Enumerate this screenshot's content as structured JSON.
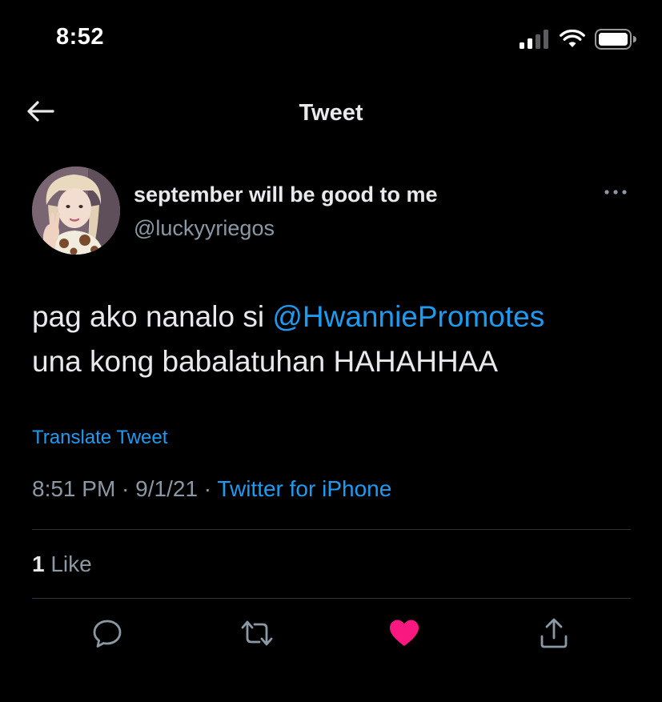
{
  "status_bar": {
    "time": "8:52",
    "icons": [
      "cellular-signal-icon",
      "wifi-icon",
      "battery-icon"
    ]
  },
  "nav": {
    "back_icon": "arrow-left-icon",
    "title": "Tweet"
  },
  "tweet": {
    "author": {
      "display_name": "september will be good to me",
      "handle": "@luckyyriegos"
    },
    "text_line1_prefix": "pag ako nanalo si ",
    "mention": "@HwanniePromotes",
    "text_line2": "una kong babalatuhan HAHAHHAA",
    "translate_label": "Translate Tweet",
    "time": "8:51 PM",
    "separator1": " · ",
    "date": "9/1/21",
    "separator2": " · ",
    "source": "Twitter for iPhone",
    "likes_count": "1",
    "likes_label": " Like",
    "liked": true
  },
  "actions": [
    "reply-icon",
    "retweet-icon",
    "like-icon",
    "share-icon"
  ],
  "colors": {
    "background": "#000000",
    "text": "#e7e9ea",
    "secondary": "#8b98a5",
    "accent": "#1d9bf0",
    "like": "#f91880",
    "divider": "#2f3336"
  }
}
